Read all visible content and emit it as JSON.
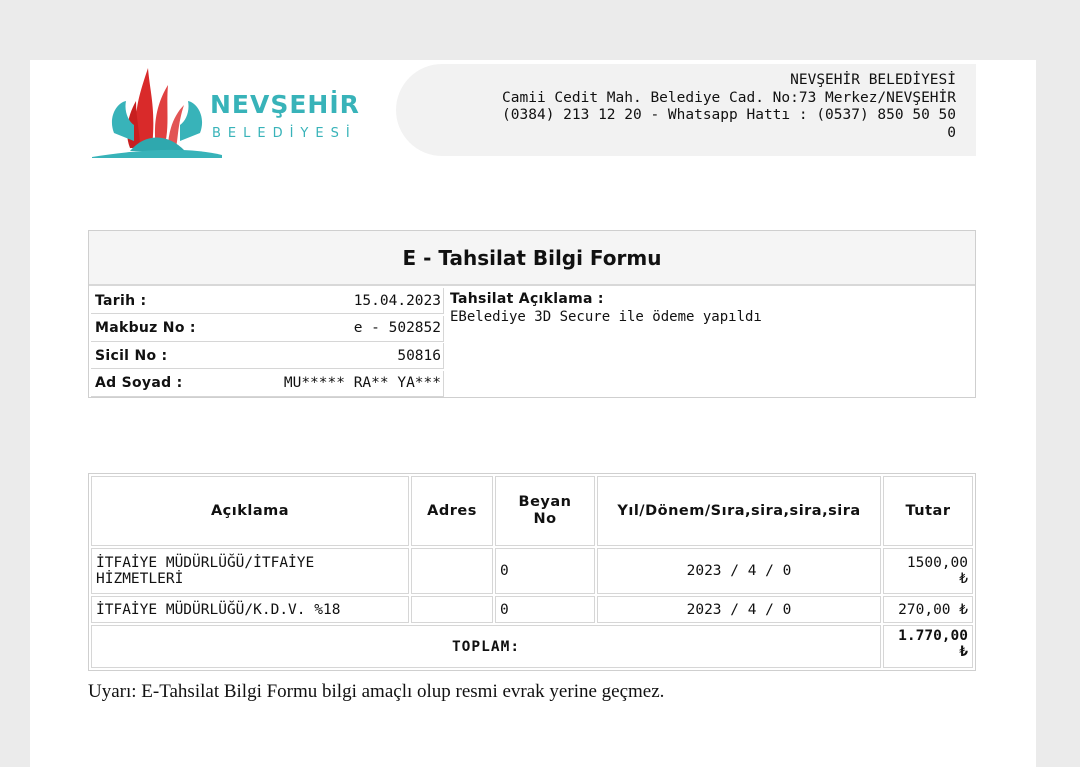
{
  "header": {
    "logo": {
      "name": "NEVŞEHİR",
      "sub": "BELEDİYESİ",
      "colors": {
        "red": "#d92a2a",
        "teal": "#38b3b9"
      }
    },
    "org_name": "NEVŞEHİR BELEDİYESİ",
    "address": "Camii Cedit Mah. Belediye Cad. No:73 Merkez/NEVŞEHİR",
    "phone": "(0384) 213 12 20 - Whatsapp Hattı : (0537) 850 50 50",
    "extra": "0"
  },
  "form": {
    "title": "E - Tahsilat Bilgi Formu",
    "rows": [
      {
        "label": "Tarih :",
        "value": "15.04.2023"
      },
      {
        "label": "Makbuz No :",
        "value": "e - 502852"
      },
      {
        "label": "Sicil No :",
        "value": "50816"
      },
      {
        "label": "Ad Soyad :",
        "value": "MU***** RA** YA***"
      }
    ],
    "description_label": "Tahsilat Açıklama :",
    "description": "EBelediye 3D Secure ile ödeme yapıldı"
  },
  "table": {
    "headers": {
      "aciklama": "Açıklama",
      "adres": "Adres",
      "beyan_1": "Beyan",
      "beyan_2": "No",
      "period": "Yıl/Dönem/Sıra,sira,sira,sira",
      "tutar": "Tutar"
    },
    "rows": [
      {
        "aciklama_1": "İTFAİYE MÜDÜRLÜĞÜ/İTFAİYE",
        "aciklama_2": "HİZMETLERİ",
        "adres": "",
        "beyan": "0",
        "period": "2023 / 4 / 0",
        "amount_1": "1500,00",
        "amount_2": "₺"
      },
      {
        "aciklama_1": "İTFAİYE MÜDÜRLÜĞÜ/K.D.V. %18",
        "adres": "",
        "beyan": "0",
        "period": "2023 / 4 / 0",
        "amount_1": "270,00 ₺"
      }
    ],
    "total_label": "TOPLAM:",
    "total_1": "1.770,00",
    "total_2": "₺"
  },
  "warning": "Uyarı: E-Tahsilat Bilgi Formu bilgi amaçlı olup resmi evrak yerine geçmez."
}
